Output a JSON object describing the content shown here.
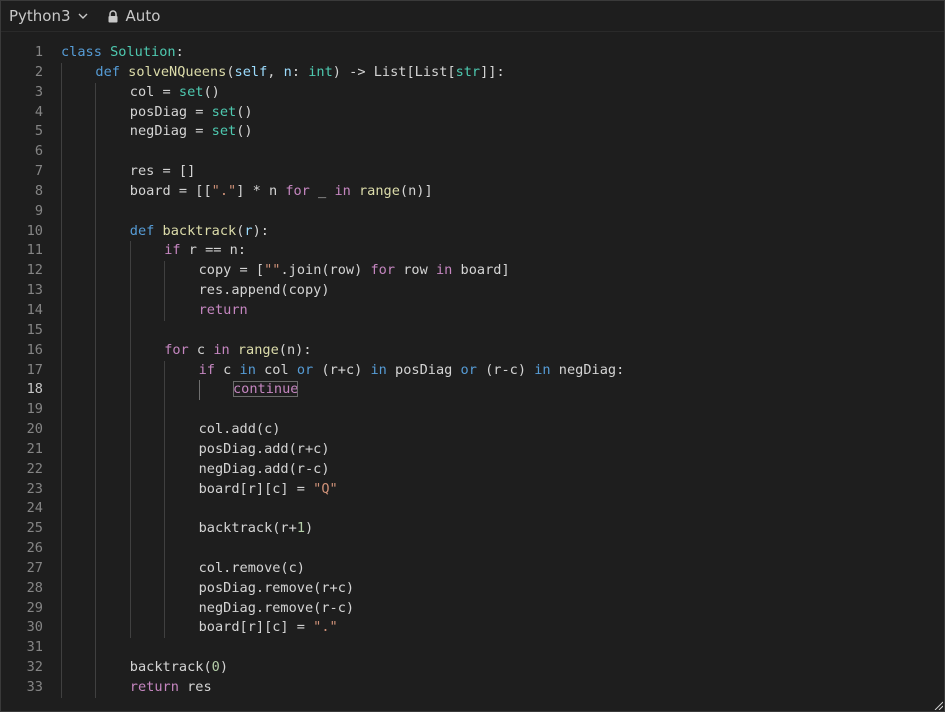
{
  "toolbar": {
    "language": "Python3",
    "mode": "Auto",
    "icons": [
      "chevron-down-icon",
      "lock-icon"
    ]
  },
  "editor": {
    "active_line": 18,
    "lines": [
      {
        "n": 1,
        "indent": 0,
        "tokens": [
          [
            "kw",
            "class"
          ],
          [
            "op",
            " "
          ],
          [
            "cls",
            "Solution"
          ],
          [
            "op",
            ":"
          ]
        ]
      },
      {
        "n": 2,
        "indent": 1,
        "tokens": [
          [
            "kw",
            "def"
          ],
          [
            "op",
            " "
          ],
          [
            "fn",
            "solveNQueens"
          ],
          [
            "op",
            "("
          ],
          [
            "param",
            "self"
          ],
          [
            "op",
            ", "
          ],
          [
            "param",
            "n"
          ],
          [
            "op",
            ": "
          ],
          [
            "cls",
            "int"
          ],
          [
            "op",
            ") -> List[List["
          ],
          [
            "cls",
            "str"
          ],
          [
            "op",
            "]]:"
          ]
        ]
      },
      {
        "n": 3,
        "indent": 2,
        "tokens": [
          [
            "op",
            "col = "
          ],
          [
            "cls",
            "set"
          ],
          [
            "op",
            "()"
          ]
        ]
      },
      {
        "n": 4,
        "indent": 2,
        "tokens": [
          [
            "op",
            "posDiag = "
          ],
          [
            "cls",
            "set"
          ],
          [
            "op",
            "()"
          ]
        ]
      },
      {
        "n": 5,
        "indent": 2,
        "tokens": [
          [
            "op",
            "negDiag = "
          ],
          [
            "cls",
            "set"
          ],
          [
            "op",
            "()"
          ]
        ]
      },
      {
        "n": 6,
        "indent": 2,
        "tokens": []
      },
      {
        "n": 7,
        "indent": 2,
        "tokens": [
          [
            "op",
            "res = []"
          ]
        ]
      },
      {
        "n": 8,
        "indent": 2,
        "tokens": [
          [
            "op",
            "board = [["
          ],
          [
            "str",
            "\".\""
          ],
          [
            "op",
            "] * n "
          ],
          [
            "ctl",
            "for"
          ],
          [
            "op",
            " _ "
          ],
          [
            "ctl",
            "in"
          ],
          [
            "op",
            " "
          ],
          [
            "fn",
            "range"
          ],
          [
            "op",
            "(n)]"
          ]
        ]
      },
      {
        "n": 9,
        "indent": 2,
        "tokens": []
      },
      {
        "n": 10,
        "indent": 2,
        "tokens": [
          [
            "kw",
            "def"
          ],
          [
            "op",
            " "
          ],
          [
            "fn",
            "backtrack"
          ],
          [
            "op",
            "("
          ],
          [
            "param",
            "r"
          ],
          [
            "op",
            "):"
          ]
        ]
      },
      {
        "n": 11,
        "indent": 3,
        "tokens": [
          [
            "ctl",
            "if"
          ],
          [
            "op",
            " r == n:"
          ]
        ]
      },
      {
        "n": 12,
        "indent": 4,
        "tokens": [
          [
            "op",
            "copy = ["
          ],
          [
            "str",
            "\"\""
          ],
          [
            "op",
            ".join(row) "
          ],
          [
            "ctl",
            "for"
          ],
          [
            "op",
            " row "
          ],
          [
            "ctl",
            "in"
          ],
          [
            "op",
            " board]"
          ]
        ]
      },
      {
        "n": 13,
        "indent": 4,
        "tokens": [
          [
            "op",
            "res.append(copy)"
          ]
        ]
      },
      {
        "n": 14,
        "indent": 4,
        "tokens": [
          [
            "ctl",
            "return"
          ]
        ]
      },
      {
        "n": 15,
        "indent": 3,
        "tokens": []
      },
      {
        "n": 16,
        "indent": 3,
        "tokens": [
          [
            "ctl",
            "for"
          ],
          [
            "op",
            " c "
          ],
          [
            "ctl",
            "in"
          ],
          [
            "op",
            " "
          ],
          [
            "fn",
            "range"
          ],
          [
            "op",
            "(n):"
          ]
        ]
      },
      {
        "n": 17,
        "indent": 4,
        "tokens": [
          [
            "ctl",
            "if"
          ],
          [
            "op",
            " c "
          ],
          [
            "kw",
            "in"
          ],
          [
            "op",
            " col "
          ],
          [
            "kw",
            "or"
          ],
          [
            "op",
            " (r+c) "
          ],
          [
            "kw",
            "in"
          ],
          [
            "op",
            " posDiag "
          ],
          [
            "kw",
            "or"
          ],
          [
            "op",
            " (r-c) "
          ],
          [
            "kw",
            "in"
          ],
          [
            "op",
            " negDiag:"
          ]
        ]
      },
      {
        "n": 18,
        "indent": 5,
        "tokens": [
          [
            "ctl cursor-word",
            "continue"
          ]
        ]
      },
      {
        "n": 19,
        "indent": 4,
        "tokens": []
      },
      {
        "n": 20,
        "indent": 4,
        "tokens": [
          [
            "op",
            "col.add(c)"
          ]
        ]
      },
      {
        "n": 21,
        "indent": 4,
        "tokens": [
          [
            "op",
            "posDiag.add(r+c)"
          ]
        ]
      },
      {
        "n": 22,
        "indent": 4,
        "tokens": [
          [
            "op",
            "negDiag.add(r-c)"
          ]
        ]
      },
      {
        "n": 23,
        "indent": 4,
        "tokens": [
          [
            "op",
            "board[r][c] = "
          ],
          [
            "str",
            "\"Q\""
          ]
        ]
      },
      {
        "n": 24,
        "indent": 4,
        "tokens": []
      },
      {
        "n": 25,
        "indent": 4,
        "tokens": [
          [
            "op",
            "backtrack(r+"
          ],
          [
            "num",
            "1"
          ],
          [
            "op",
            ")"
          ]
        ]
      },
      {
        "n": 26,
        "indent": 4,
        "tokens": []
      },
      {
        "n": 27,
        "indent": 4,
        "tokens": [
          [
            "op",
            "col.remove(c)"
          ]
        ]
      },
      {
        "n": 28,
        "indent": 4,
        "tokens": [
          [
            "op",
            "posDiag.remove(r+c)"
          ]
        ]
      },
      {
        "n": 29,
        "indent": 4,
        "tokens": [
          [
            "op",
            "negDiag.remove(r-c)"
          ]
        ]
      },
      {
        "n": 30,
        "indent": 4,
        "tokens": [
          [
            "op",
            "board[r][c] = "
          ],
          [
            "str",
            "\".\""
          ]
        ]
      },
      {
        "n": 31,
        "indent": 2,
        "tokens": []
      },
      {
        "n": 32,
        "indent": 2,
        "tokens": [
          [
            "op",
            "backtrack("
          ],
          [
            "num",
            "0"
          ],
          [
            "op",
            ")"
          ]
        ]
      },
      {
        "n": 33,
        "indent": 2,
        "tokens": [
          [
            "ctl",
            "return"
          ],
          [
            "op",
            " res"
          ]
        ]
      }
    ]
  }
}
